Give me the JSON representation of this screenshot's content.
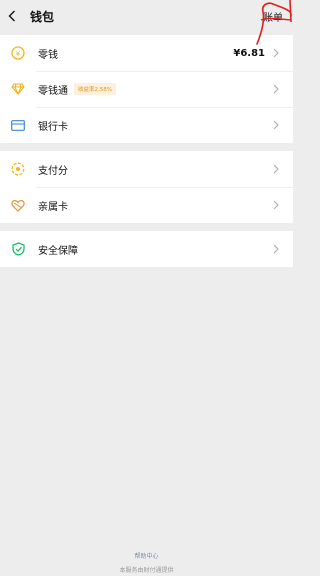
{
  "header": {
    "title": "钱包",
    "right_label": "账单"
  },
  "groups": [
    [
      {
        "label": "零钱",
        "value": "¥6.81",
        "icon": "coin-icon"
      },
      {
        "label": "零钱通",
        "badge": "收益率2.58%",
        "icon": "diamond-icon"
      },
      {
        "label": "银行卡",
        "icon": "card-icon"
      }
    ],
    [
      {
        "label": "支付分",
        "icon": "score-icon"
      },
      {
        "label": "亲属卡",
        "icon": "heart-card-icon"
      }
    ],
    [
      {
        "label": "安全保障",
        "icon": "shield-icon"
      }
    ]
  ],
  "footer": {
    "help": "帮助中心",
    "note": "本服务由财付通提供"
  },
  "colors": {
    "accent": "#f2b51f",
    "blue": "#3a86d8",
    "green": "#07c160",
    "annotation": "#e02020"
  }
}
